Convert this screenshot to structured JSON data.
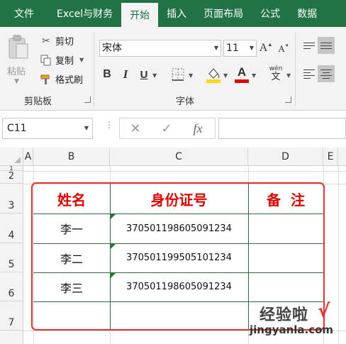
{
  "ribbon_tabs": [
    "文件",
    "Excel与财务",
    "开始",
    "插入",
    "页面布局",
    "公式",
    "数据"
  ],
  "active_tab": "开始",
  "clipboard": {
    "paste_label": "粘贴",
    "cut_label": "剪切",
    "copy_label": "复制",
    "format_painter_label": "格式刷",
    "group_label": "剪贴板"
  },
  "font_group": {
    "font_name": "宋体",
    "font_size": "11",
    "group_label": "字体",
    "bold": "B",
    "italic": "I",
    "underline": "U",
    "font_color_label": "A",
    "grow_font": "A",
    "shrink_font": "A",
    "phonetic_top": "wén",
    "phonetic_bottom": "文"
  },
  "formula_bar": {
    "name_box": "C11",
    "fx_label": "fx",
    "cancel_glyph": "✕",
    "enter_glyph": "✓",
    "formula": ""
  },
  "sheet": {
    "columns": [
      "A",
      "B",
      "C",
      "D",
      "E"
    ],
    "rows": [
      "1",
      "2",
      "3",
      "4",
      "5",
      "6",
      "7"
    ],
    "table_headers": [
      "姓名",
      "身份证号",
      "备  注"
    ],
    "data_rows": [
      {
        "name": "李一",
        "id": "370501198605091234",
        "note": ""
      },
      {
        "name": "李二",
        "id": "370501199505101234",
        "note": ""
      },
      {
        "name": "李三",
        "id": "370501198605091234",
        "note": ""
      }
    ]
  },
  "watermark": {
    "cn": "经验啦",
    "check": "√",
    "url": "jingyanla.com"
  },
  "colors": {
    "ribbon_green": "#217346",
    "header_text_red": "#e00000",
    "frame_red": "#e8322f",
    "table_border_green": "#2e6b3d",
    "highlight_yellow": "#ffd800"
  }
}
